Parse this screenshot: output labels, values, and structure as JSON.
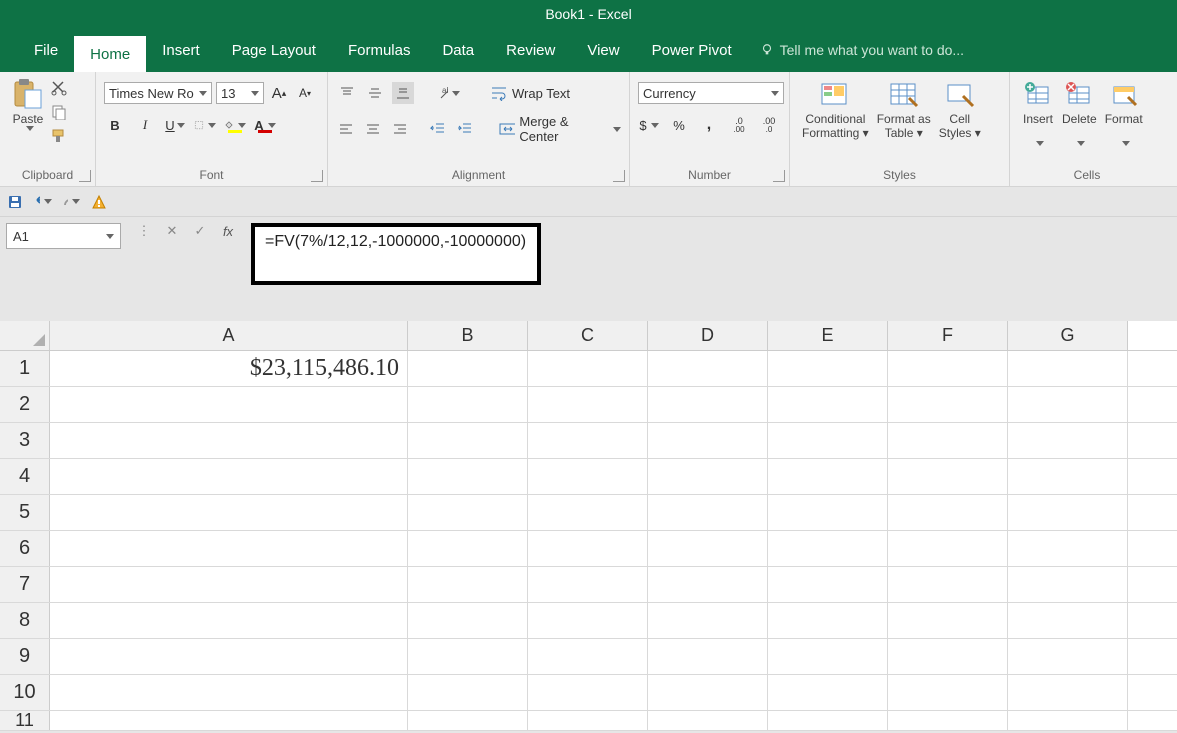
{
  "title": "Book1 - Excel",
  "tabs": {
    "file": "File",
    "home": "Home",
    "insert": "Insert",
    "pageLayout": "Page Layout",
    "formulas": "Formulas",
    "data": "Data",
    "review": "Review",
    "view": "View",
    "powerPivot": "Power Pivot"
  },
  "tellme": "Tell me what you want to do...",
  "ribbon": {
    "clipboard": {
      "paste": "Paste",
      "label": "Clipboard"
    },
    "font": {
      "name": "Times New Ro",
      "size": "13",
      "bold": "B",
      "italic": "I",
      "underline": "U",
      "label": "Font"
    },
    "alignment": {
      "wrap": "Wrap Text",
      "merge": "Merge & Center",
      "label": "Alignment"
    },
    "number": {
      "format": "Currency",
      "dollar": "$",
      "percent": "%",
      "comma": ",",
      "inc": ".0",
      "dec": ".00",
      "label": "Number"
    },
    "styles": {
      "cond": "Conditional Formatting",
      "table": "Format as Table",
      "cell": "Cell Styles",
      "label": "Styles"
    },
    "cells": {
      "insert": "Insert",
      "delete": "Delete",
      "format": "Format",
      "label": "Cells"
    }
  },
  "namebox": "A1",
  "formula": "=FV(7%/12,12,-1000000,-10000000)",
  "columns": [
    "A",
    "B",
    "C",
    "D",
    "E",
    "F",
    "G"
  ],
  "rows": [
    "1",
    "2",
    "3",
    "4",
    "5",
    "6",
    "7",
    "8",
    "9",
    "10",
    "11"
  ],
  "cellA1": "$23,115,486.10"
}
